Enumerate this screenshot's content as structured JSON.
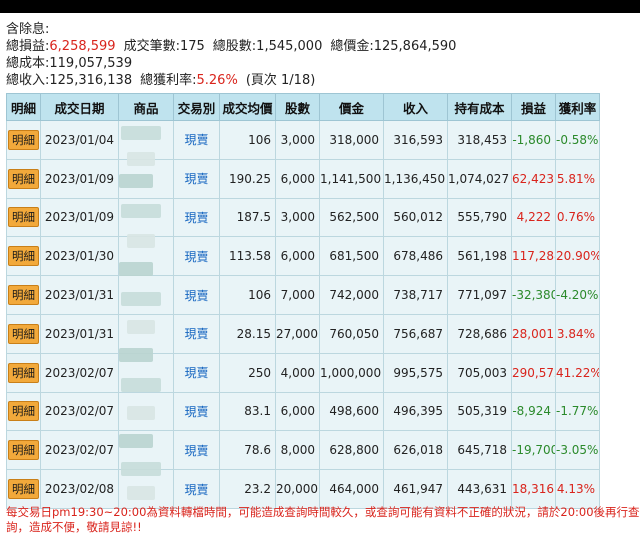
{
  "summary": {
    "title": "含除息:",
    "total_pnl_label": "總損益:",
    "total_pnl": "6,258,599",
    "trade_count_label": "成交筆數:",
    "trade_count": "175",
    "total_shares_label": "總股數:",
    "total_shares": "1,545,000",
    "total_value_label": "總價金:",
    "total_value": "125,864,590",
    "total_cost_label": "總成本:",
    "total_cost": "119,057,539",
    "total_income_label": "總收入:",
    "total_income": "125,316,138",
    "total_rate_label": "總獲利率:",
    "total_rate": "5.26%",
    "page_info": "(頁次 1/18)"
  },
  "table": {
    "headers": [
      "明細",
      "成交日期",
      "商品",
      "交易別",
      "成交均價",
      "股數",
      "價金",
      "收入",
      "持有成本",
      "損益",
      "獲利率"
    ],
    "detail_label": "明細",
    "rows": [
      {
        "date": "2023/01/04",
        "product": "",
        "type": "現賣",
        "price": "106",
        "shares": "3,000",
        "value": "318,000",
        "income": "316,593",
        "cost": "318,453",
        "pnl": "-1,860",
        "rate": "-0.58%",
        "sign": "neg"
      },
      {
        "date": "2023/01/09",
        "product": "",
        "type": "現賣",
        "price": "190.25",
        "shares": "6,000",
        "value": "1,141,500",
        "income": "1,136,450",
        "cost": "1,074,027",
        "pnl": "62,423",
        "rate": "5.81%",
        "sign": "pos"
      },
      {
        "date": "2023/01/09",
        "product": "",
        "type": "現賣",
        "price": "187.5",
        "shares": "3,000",
        "value": "562,500",
        "income": "560,012",
        "cost": "555,790",
        "pnl": "4,222",
        "rate": "0.76%",
        "sign": "pos"
      },
      {
        "date": "2023/01/30",
        "product": "",
        "type": "現賣",
        "price": "113.58",
        "shares": "6,000",
        "value": "681,500",
        "income": "678,486",
        "cost": "561,198",
        "pnl": "117,288",
        "rate": "20.90%",
        "sign": "pos"
      },
      {
        "date": "2023/01/31",
        "product": "",
        "type": "現賣",
        "price": "106",
        "shares": "7,000",
        "value": "742,000",
        "income": "738,717",
        "cost": "771,097",
        "pnl": "-32,380",
        "rate": "-4.20%",
        "sign": "neg"
      },
      {
        "date": "2023/01/31",
        "product": "",
        "type": "現賣",
        "price": "28.15",
        "shares": "27,000",
        "value": "760,050",
        "income": "756,687",
        "cost": "728,686",
        "pnl": "28,001",
        "rate": "3.84%",
        "sign": "pos"
      },
      {
        "date": "2023/02/07",
        "product": "",
        "type": "現賣",
        "price": "250",
        "shares": "4,000",
        "value": "1,000,000",
        "income": "995,575",
        "cost": "705,003",
        "pnl": "290,572",
        "rate": "41.22%",
        "sign": "pos"
      },
      {
        "date": "2023/02/07",
        "product": "",
        "type": "現賣",
        "price": "83.1",
        "shares": "6,000",
        "value": "498,600",
        "income": "496,395",
        "cost": "505,319",
        "pnl": "-8,924",
        "rate": "-1.77%",
        "sign": "neg"
      },
      {
        "date": "2023/02/07",
        "product": "",
        "type": "現賣",
        "price": "78.6",
        "shares": "8,000",
        "value": "628,800",
        "income": "626,018",
        "cost": "645,718",
        "pnl": "-19,700",
        "rate": "-3.05%",
        "sign": "neg"
      },
      {
        "date": "2023/02/08",
        "product": "",
        "type": "現賣",
        "price": "23.2",
        "shares": "20,000",
        "value": "464,000",
        "income": "461,947",
        "cost": "443,631",
        "pnl": "18,316",
        "rate": "4.13%",
        "sign": "pos"
      }
    ]
  },
  "footnote": "每交易日pm19:30~20:00為資料轉檔時間，可能造成查詢時間較久，或查詢可能有資料不正確的狀況，請於20:00後再行查詢，造成不便，敬請見諒!!",
  "colors": {
    "header_bg": "#bfe3ee",
    "row_bg": "#e9f4f7",
    "detail_button": "#f2a93b",
    "positive": "#d9241c",
    "negative": "#2b8a2b",
    "trade_type": "#1565c0"
  }
}
